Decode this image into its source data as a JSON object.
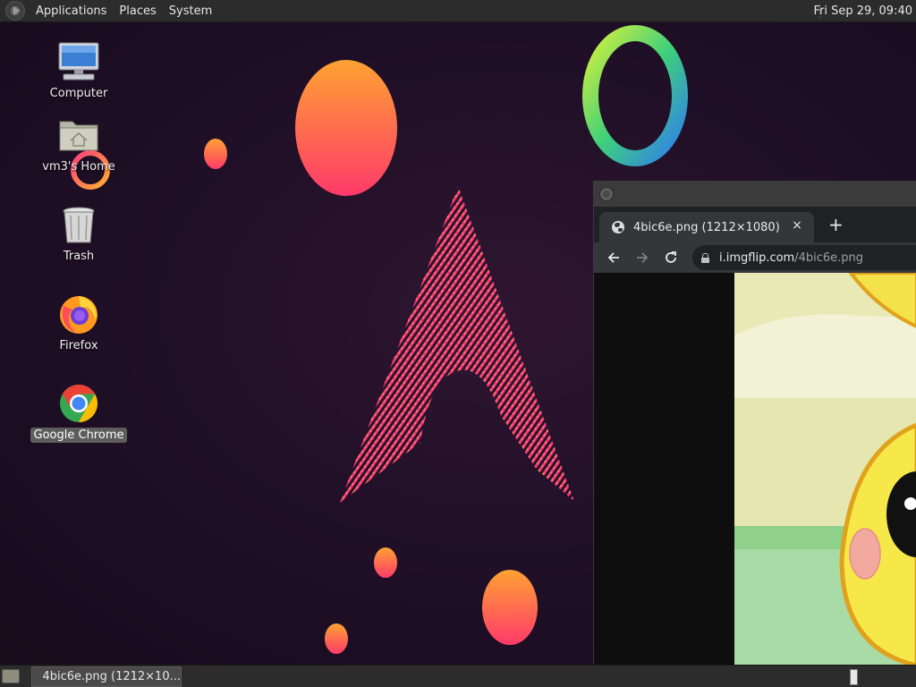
{
  "top_panel": {
    "menus": [
      "Applications",
      "Places",
      "System"
    ],
    "clock": "Fri Sep 29, 09:40"
  },
  "desktop": {
    "icons": [
      {
        "label": "Computer",
        "icon": "computer-icon"
      },
      {
        "label": "vm3's Home",
        "icon": "home-folder-icon"
      },
      {
        "label": "Trash",
        "icon": "trash-icon"
      },
      {
        "label": "Firefox",
        "icon": "firefox-icon"
      },
      {
        "label": "Google Chrome",
        "icon": "chrome-icon",
        "selected": true
      }
    ]
  },
  "browser": {
    "tab_title": "4bic6e.png (1212×1080)",
    "tab_close": "×",
    "new_tab": "+",
    "url_host": "i.imgflip.com",
    "url_path": "/4bic6e.png"
  },
  "taskbar": {
    "task_label": "4bic6e.png (1212×10..."
  },
  "colors": {
    "panel": "#2c2c2c",
    "desktop_bg": "#211028",
    "browser_dark": "#202124",
    "toolbar": "#35363a"
  }
}
